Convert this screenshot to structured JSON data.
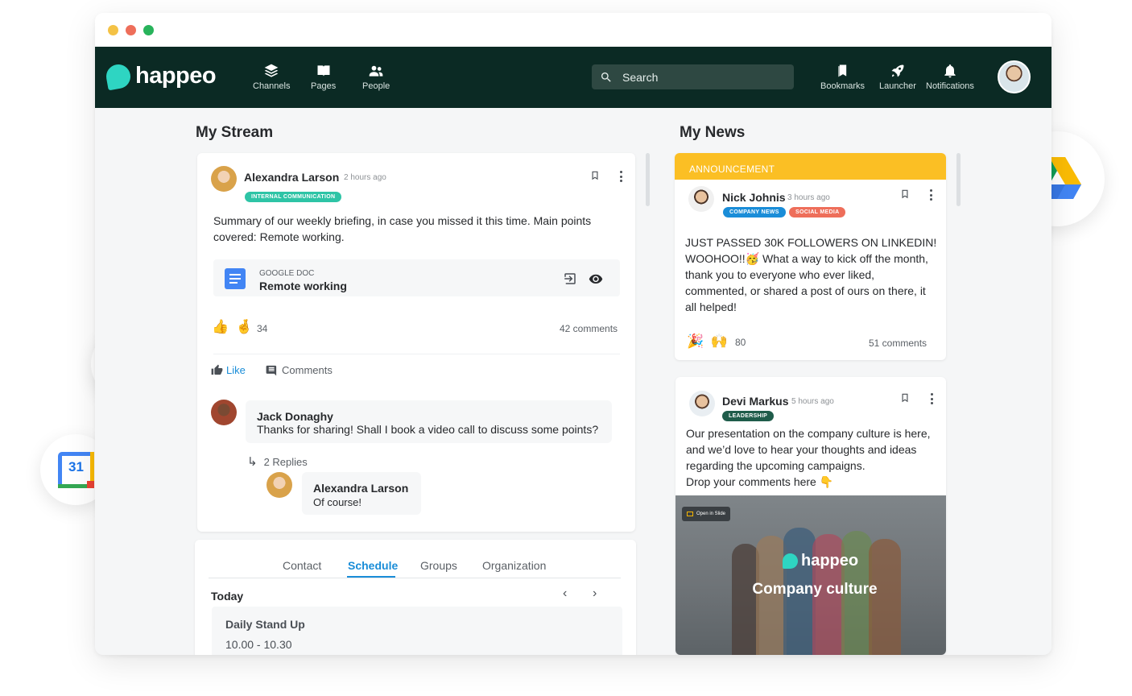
{
  "nav": {
    "logo": "happeo",
    "left_items": [
      {
        "label": "Channels",
        "icon": "layers-icon"
      },
      {
        "label": "Pages",
        "icon": "book-icon"
      },
      {
        "label": "People",
        "icon": "people-icon"
      }
    ],
    "search_placeholder": "Search",
    "right_items": [
      {
        "label": "Bookmarks",
        "icon": "bookmarks-icon"
      },
      {
        "label": "Launcher",
        "icon": "rocket-icon"
      },
      {
        "label": "Notifications",
        "icon": "bell-icon"
      }
    ]
  },
  "stream": {
    "title": "My Stream",
    "post": {
      "author": "Alexandra Larson",
      "time": "2 hours ago",
      "tag": "INTERNAL COMMUNICATION",
      "text": "Summary of our weekly briefing, in case you missed it this time. Main points covered: Remote working.",
      "attachment": {
        "type": "GOOGLE DOC",
        "name": "Remote working"
      },
      "reactions": "👍 🤞",
      "reaction_count": "34",
      "comments_count": "42 comments",
      "like_label": "Like",
      "comments_label": "Comments",
      "comment": {
        "author": "Jack Donaghy",
        "text": "Thanks for sharing! Shall I book a video call to discuss some points?"
      },
      "replies_label": "2 Replies",
      "reply": {
        "author": "Alexandra Larson",
        "text": "Of course!"
      }
    }
  },
  "profile": {
    "tabs": [
      "Contact",
      "Schedule",
      "Groups",
      "Organization"
    ],
    "active_tab": "Schedule",
    "day": "Today",
    "event": {
      "title": "Daily Stand Up",
      "time": "10.00 - 10.30"
    }
  },
  "news": {
    "title": "My News",
    "announcement": {
      "banner": "ANNOUNCEMENT",
      "author": "Nick Johnis",
      "time": "3 hours ago",
      "tags": [
        "COMPANY NEWS",
        "SOCIAL MEDIA"
      ],
      "text": "JUST PASSED 30K FOLLOWERS ON LINKEDIN! WOOHOO!!🥳 What a way to kick off the month, thank you to everyone who ever liked, commented, or shared a post of ours on there, it all helped!",
      "reactions": "🎉 🙌",
      "reaction_count": "80",
      "comments_count": "51 comments"
    },
    "post2": {
      "author": "Devi Markus",
      "time": "5 hours ago",
      "tag": "LEADERSHIP",
      "text": "Our presentation on the company culture is here, and we’d love to hear your thoughts and ideas regarding the upcoming campaigns.\nDrop your comments here 👇",
      "image": {
        "badge": "Open in Slide",
        "logo": "happeo",
        "caption": "Company culture"
      }
    }
  },
  "integrations": [
    "google-drive-icon",
    "google-icon",
    "google-calendar-icon"
  ],
  "calendar_day": "31",
  "colors": {
    "nav_bg": "#0b2a24",
    "accent": "#2ed5c2",
    "link": "#1a8dd8",
    "announcement": "#fbbf24",
    "tag_internal": "#2ec4a6",
    "tag_company": "#1a8dd8",
    "tag_social": "#ee6e5a",
    "tag_leadership": "#1f5c4a"
  }
}
